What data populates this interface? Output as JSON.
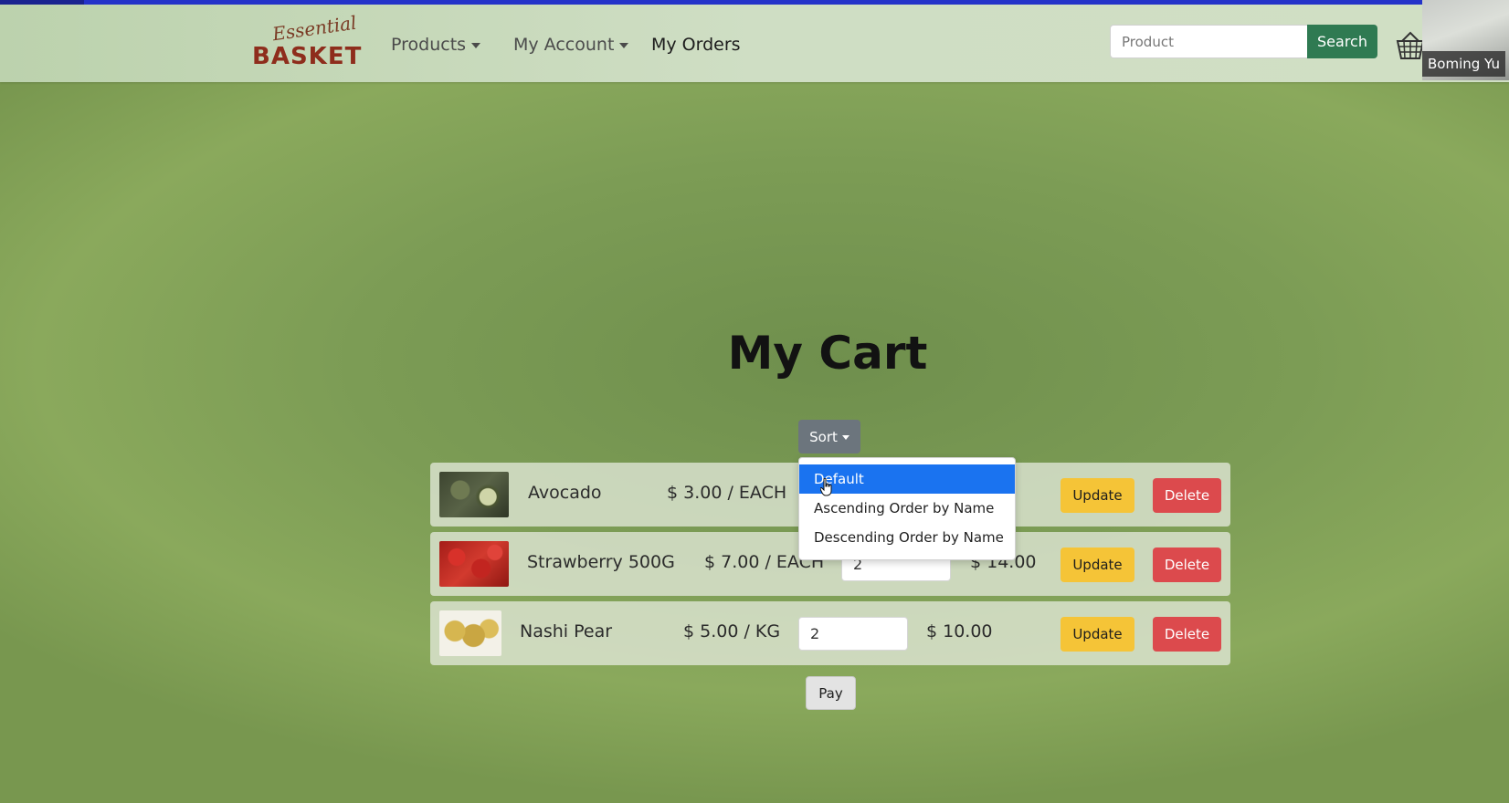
{
  "header": {
    "logo_script": "Essential",
    "logo_main": "BASKET",
    "nav": {
      "products": "Products",
      "my_account": "My Account",
      "my_orders": "My Orders"
    },
    "search": {
      "placeholder": "Product",
      "button": "Search"
    },
    "basket_icon": "basket-icon"
  },
  "webcam": {
    "name": "Boming Yu"
  },
  "cart": {
    "title": "My Cart",
    "sort_button": "Sort",
    "sort_options": [
      {
        "label": "Default",
        "selected": true
      },
      {
        "label": "Ascending Order by Name",
        "selected": false
      },
      {
        "label": "Descending Order by Name",
        "selected": false
      }
    ],
    "items": [
      {
        "name": "Avocado",
        "price": "$ 3.00 / EACH",
        "quantity": "",
        "total": "",
        "update": "Update",
        "delete": "Delete"
      },
      {
        "name": "Strawberry 500G",
        "price": "$ 7.00 / EACH",
        "quantity": "2",
        "total": "$ 14.00",
        "update": "Update",
        "delete": "Delete"
      },
      {
        "name": "Nashi Pear",
        "price": "$ 5.00 / KG",
        "quantity": "2",
        "total": "$ 10.00",
        "update": "Update",
        "delete": "Delete"
      }
    ],
    "pay_button": "Pay"
  },
  "colors": {
    "accent_blue": "#2433c9",
    "search_green": "#2f7a52",
    "update_yellow": "#f5c437",
    "delete_red": "#dc4a4d",
    "sort_gray": "#6c757d",
    "selected_blue": "#1a73f0"
  }
}
